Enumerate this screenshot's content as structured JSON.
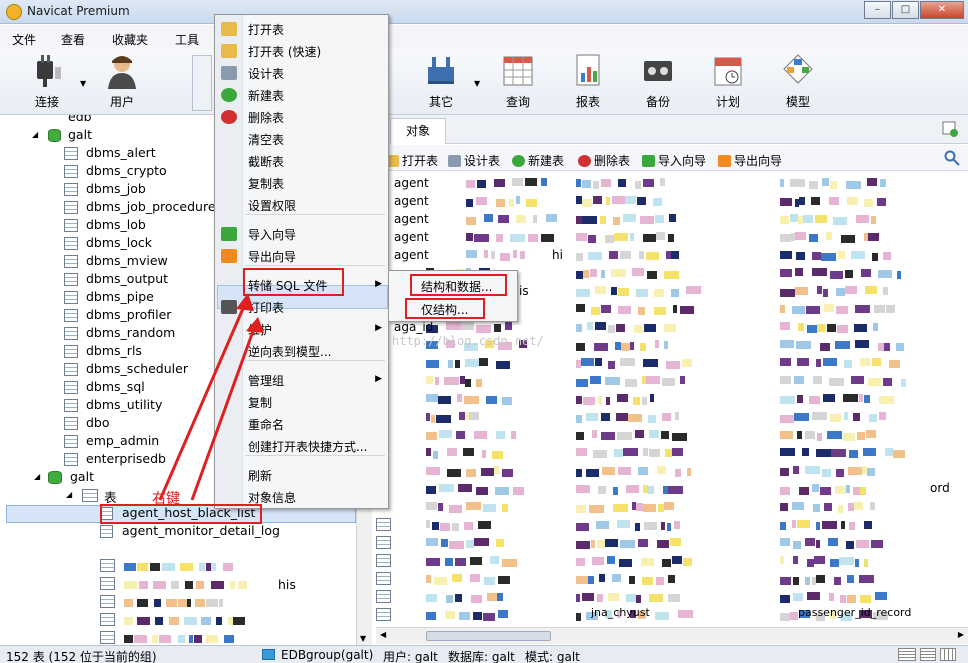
{
  "window": {
    "title": "Navicat Premium"
  },
  "menubar": [
    "文件",
    "查看",
    "收藏夹",
    "工具"
  ],
  "toolbar": {
    "connect": "连接",
    "user": "用户",
    "other": "其它",
    "query": "查询",
    "report": "报表",
    "backup": "备份",
    "schedule": "计划",
    "model": "模型"
  },
  "tree": {
    "top_partial": "edb",
    "schema": "galt",
    "schemas": [
      "dbms_alert",
      "dbms_crypto",
      "dbms_job",
      "dbms_job_procedure",
      "dbms_lob",
      "dbms_lock",
      "dbms_mview",
      "dbms_output",
      "dbms_pipe",
      "dbms_profiler",
      "dbms_random",
      "dbms_rls",
      "dbms_scheduler",
      "dbms_sql",
      "dbms_utility",
      "dbo",
      "emp_admin",
      "enterprisedb",
      "galt"
    ],
    "tables_node": "表",
    "tables": [
      "agent_host_black_list",
      "agent_monitor_detail_log"
    ],
    "partial_table_suffix": "his"
  },
  "object_tab": {
    "label": "对象"
  },
  "object_toolbar": {
    "open": "打开表",
    "design": "设计表",
    "new": "新建表",
    "delete": "删除表",
    "import": "导入向导",
    "export": "导出向导"
  },
  "object_list": {
    "visible_prefixes": [
      "agent",
      "agent",
      "agent",
      "agent",
      "agent"
    ],
    "fragments": [
      "hi",
      "is",
      "aga_id",
      "ord",
      "jna_chyust",
      "passenger_id_record"
    ]
  },
  "context_menu": {
    "items": [
      "打开表",
      "打开表 (快速)",
      "设计表",
      "新建表",
      "删除表",
      "清空表",
      "截断表",
      "复制表",
      "设置权限",
      "导入向导",
      "导出向导",
      "转储 SQL 文件",
      "打印表",
      "维护",
      "逆向表到模型...",
      "管理组",
      "复制",
      "重命名",
      "创建打开表快捷方式...",
      "刷新",
      "对象信息"
    ]
  },
  "submenu": {
    "items": [
      "结构和数据...",
      "仅结构..."
    ]
  },
  "annotation": {
    "label": "右键"
  },
  "watermark": "http://blog.csdn.net/",
  "statusbar": {
    "count": "152 表 (152 位于当前的组)",
    "connection": "EDBgroup(galt)",
    "user": "用户: galt",
    "database": "数据库: galt",
    "schema": "模式: galt"
  },
  "colors": {
    "highlight": "#d5e4f7",
    "annotation_red": "#e02020"
  }
}
